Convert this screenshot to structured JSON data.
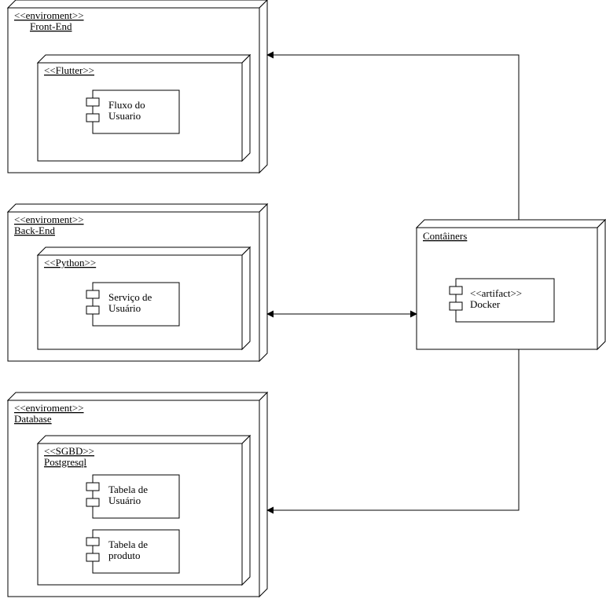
{
  "nodes": {
    "frontend": {
      "stereotype": "<<enviroment>>",
      "title": "Front-End",
      "inner": {
        "stereotype": "<<Flutter>>",
        "components": [
          {
            "label": "Fluxo do\nUsuario"
          }
        ]
      }
    },
    "backend": {
      "stereotype": "<<enviroment>>",
      "title": "Back-End",
      "inner": {
        "stereotype": "<<Python>>",
        "components": [
          {
            "label": "Serviço de\nUsuário"
          }
        ]
      }
    },
    "database": {
      "stereotype": "<<enviroment>>",
      "title": "Database",
      "inner": {
        "stereotype": "<<SGBD>>",
        "title": "Postgresql",
        "components": [
          {
            "label": "Tabela de\nUsuário"
          },
          {
            "label": "Tabela de\nproduto"
          }
        ]
      }
    },
    "containers": {
      "title": "Contâiners",
      "components": [
        {
          "stereotype": "<<artifact>>",
          "label": "Docker"
        }
      ]
    }
  },
  "edges": [
    {
      "from": "containers",
      "to": "frontend",
      "bidir": false
    },
    {
      "from": "backend",
      "to": "containers",
      "bidir": true
    },
    {
      "from": "containers",
      "to": "database",
      "bidir": false
    }
  ]
}
